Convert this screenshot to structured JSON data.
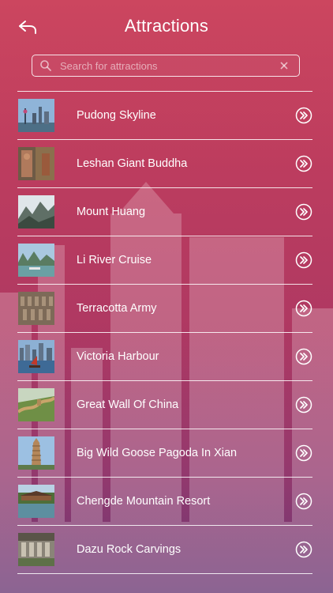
{
  "header": {
    "title": "Attractions",
    "back_icon": "back-arrow-icon"
  },
  "search": {
    "placeholder": "Search for attractions",
    "value": "",
    "icon": "search-icon",
    "clear_icon": "clear-icon"
  },
  "theme": {
    "accent": "#c8465f",
    "text": "#ffffff"
  },
  "attractions": [
    {
      "label": "Pudong Skyline",
      "thumb": "city-skyline"
    },
    {
      "label": "Leshan Giant Buddha",
      "thumb": "buddha-cliff"
    },
    {
      "label": "Mount Huang",
      "thumb": "misty-mountain"
    },
    {
      "label": "Li River Cruise",
      "thumb": "river-karst"
    },
    {
      "label": "Terracotta Army",
      "thumb": "warriors"
    },
    {
      "label": "Victoria Harbour",
      "thumb": "harbour"
    },
    {
      "label": "Great Wall Of China",
      "thumb": "great-wall"
    },
    {
      "label": "Big Wild Goose Pagoda In Xian",
      "thumb": "pagoda"
    },
    {
      "label": "Chengde Mountain Resort",
      "thumb": "resort-lake"
    },
    {
      "label": "Dazu Rock Carvings",
      "thumb": "rock-carvings"
    }
  ]
}
